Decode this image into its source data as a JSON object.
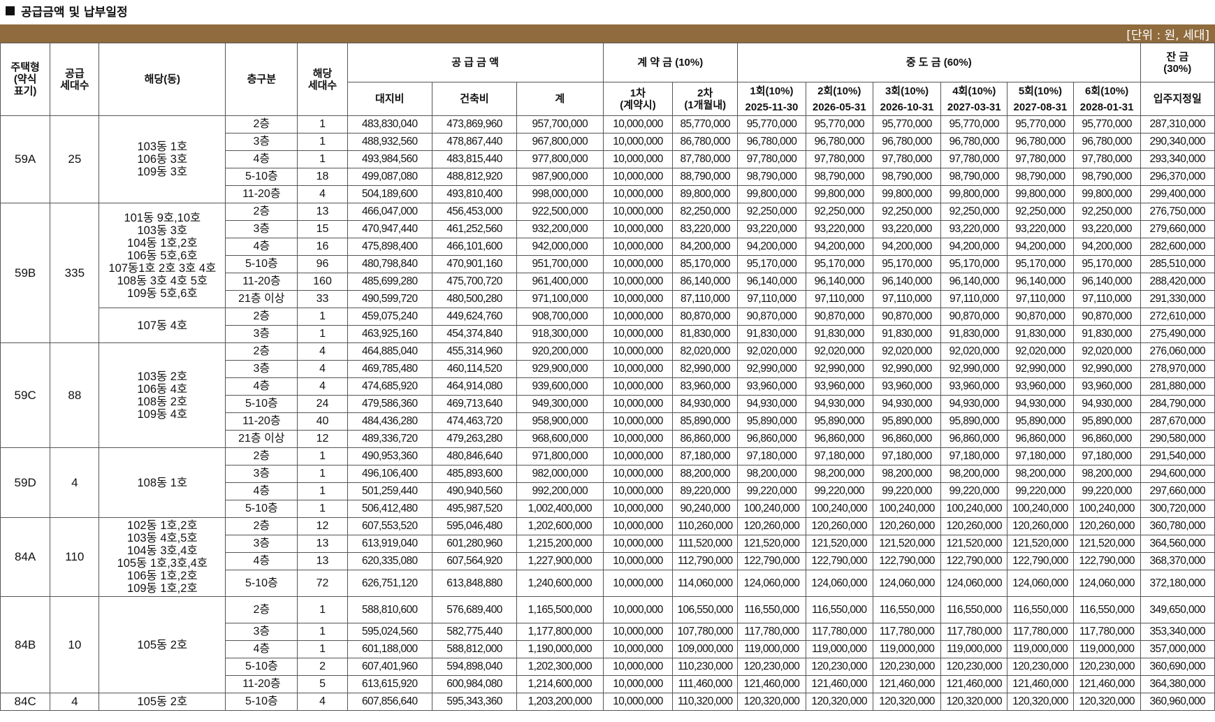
{
  "title": "공급금액 및 납부일정",
  "unit_note": "[단위 : 원, 세대]",
  "headers": {
    "house_type": [
      "주택형",
      "(약식",
      "표기)"
    ],
    "supply_units": [
      "공급",
      "세대수"
    ],
    "dong": "해당(동)",
    "floor": "층구분",
    "units": [
      "해당",
      "세대수"
    ],
    "supply_price": "공 급 금 액",
    "land": "대지비",
    "building": "건축비",
    "total": "계",
    "deposit": "계 약 금 (10%)",
    "dep1": [
      "1차",
      "(계약시)"
    ],
    "dep2": [
      "2차",
      "(1개월내)"
    ],
    "middle": "중 도 금 (60%)",
    "middle_rounds": [
      "1회(10%)",
      "2회(10%)",
      "3회(10%)",
      "4회(10%)",
      "5회(10%)",
      "6회(10%)"
    ],
    "middle_dates": [
      "2025-11-30",
      "2026-05-31",
      "2026-10-31",
      "2027-03-31",
      "2027-08-31",
      "2028-01-31"
    ],
    "balance": [
      "잔 금",
      "(30%)"
    ],
    "move_in": "입주지정일"
  },
  "groups": [
    {
      "type": "59A",
      "supply": "25",
      "blocks": [
        {
          "dong": [
            "103동 1호",
            "106동 3호",
            "109동 3호"
          ],
          "rows": [
            {
              "floor": "2층",
              "units": "1",
              "land": "483,830,040",
              "building": "473,869,960",
              "total": "957,700,000",
              "d1": "10,000,000",
              "d2": "85,770,000",
              "m": "95,770,000",
              "bal": "287,310,000"
            },
            {
              "floor": "3층",
              "units": "1",
              "land": "488,932,560",
              "building": "478,867,440",
              "total": "967,800,000",
              "d1": "10,000,000",
              "d2": "86,780,000",
              "m": "96,780,000",
              "bal": "290,340,000"
            },
            {
              "floor": "4층",
              "units": "1",
              "land": "493,984,560",
              "building": "483,815,440",
              "total": "977,800,000",
              "d1": "10,000,000",
              "d2": "87,780,000",
              "m": "97,780,000",
              "bal": "293,340,000"
            },
            {
              "floor": "5-10층",
              "units": "18",
              "land": "499,087,080",
              "building": "488,812,920",
              "total": "987,900,000",
              "d1": "10,000,000",
              "d2": "88,790,000",
              "m": "98,790,000",
              "bal": "296,370,000"
            },
            {
              "floor": "11-20층",
              "units": "4",
              "land": "504,189,600",
              "building": "493,810,400",
              "total": "998,000,000",
              "d1": "10,000,000",
              "d2": "89,800,000",
              "m": "99,800,000",
              "bal": "299,400,000"
            }
          ]
        }
      ]
    },
    {
      "type": "59B",
      "supply": "335",
      "blocks": [
        {
          "dong": [
            "101동 9호,10호",
            "103동 3호",
            "104동 1호,2호",
            "106동 5호,6호",
            "107동1호 2호 3호 4호",
            "108동 3호 4호 5호",
            "109동 5호,6호"
          ],
          "rows": [
            {
              "floor": "2층",
              "units": "13",
              "land": "466,047,000",
              "building": "456,453,000",
              "total": "922,500,000",
              "d1": "10,000,000",
              "d2": "82,250,000",
              "m": "92,250,000",
              "bal": "276,750,000"
            },
            {
              "floor": "3층",
              "units": "15",
              "land": "470,947,440",
              "building": "461,252,560",
              "total": "932,200,000",
              "d1": "10,000,000",
              "d2": "83,220,000",
              "m": "93,220,000",
              "bal": "279,660,000"
            },
            {
              "floor": "4층",
              "units": "16",
              "land": "475,898,400",
              "building": "466,101,600",
              "total": "942,000,000",
              "d1": "10,000,000",
              "d2": "84,200,000",
              "m": "94,200,000",
              "bal": "282,600,000"
            },
            {
              "floor": "5-10층",
              "units": "96",
              "land": "480,798,840",
              "building": "470,901,160",
              "total": "951,700,000",
              "d1": "10,000,000",
              "d2": "85,170,000",
              "m": "95,170,000",
              "bal": "285,510,000"
            },
            {
              "floor": "11-20층",
              "units": "160",
              "land": "485,699,280",
              "building": "475,700,720",
              "total": "961,400,000",
              "d1": "10,000,000",
              "d2": "86,140,000",
              "m": "96,140,000",
              "bal": "288,420,000"
            },
            {
              "floor": "21층 이상",
              "units": "33",
              "land": "490,599,720",
              "building": "480,500,280",
              "total": "971,100,000",
              "d1": "10,000,000",
              "d2": "87,110,000",
              "m": "97,110,000",
              "bal": "291,330,000"
            }
          ]
        },
        {
          "dong": [
            "107동 4호"
          ],
          "rows": [
            {
              "floor": "2층",
              "units": "1",
              "land": "459,075,240",
              "building": "449,624,760",
              "total": "908,700,000",
              "d1": "10,000,000",
              "d2": "80,870,000",
              "m": "90,870,000",
              "bal": "272,610,000"
            },
            {
              "floor": "3층",
              "units": "1",
              "land": "463,925,160",
              "building": "454,374,840",
              "total": "918,300,000",
              "d1": "10,000,000",
              "d2": "81,830,000",
              "m": "91,830,000",
              "bal": "275,490,000"
            }
          ]
        }
      ]
    },
    {
      "type": "59C",
      "supply": "88",
      "blocks": [
        {
          "dong": [
            "103동 2호",
            "106동 4호",
            "108동 2호",
            "109동 4호"
          ],
          "rows": [
            {
              "floor": "2층",
              "units": "4",
              "land": "464,885,040",
              "building": "455,314,960",
              "total": "920,200,000",
              "d1": "10,000,000",
              "d2": "82,020,000",
              "m": "92,020,000",
              "bal": "276,060,000"
            },
            {
              "floor": "3층",
              "units": "4",
              "land": "469,785,480",
              "building": "460,114,520",
              "total": "929,900,000",
              "d1": "10,000,000",
              "d2": "82,990,000",
              "m": "92,990,000",
              "bal": "278,970,000"
            },
            {
              "floor": "4층",
              "units": "4",
              "land": "474,685,920",
              "building": "464,914,080",
              "total": "939,600,000",
              "d1": "10,000,000",
              "d2": "83,960,000",
              "m": "93,960,000",
              "bal": "281,880,000"
            },
            {
              "floor": "5-10층",
              "units": "24",
              "land": "479,586,360",
              "building": "469,713,640",
              "total": "949,300,000",
              "d1": "10,000,000",
              "d2": "84,930,000",
              "m": "94,930,000",
              "bal": "284,790,000"
            },
            {
              "floor": "11-20층",
              "units": "40",
              "land": "484,436,280",
              "building": "474,463,720",
              "total": "958,900,000",
              "d1": "10,000,000",
              "d2": "85,890,000",
              "m": "95,890,000",
              "bal": "287,670,000"
            },
            {
              "floor": "21층 이상",
              "units": "12",
              "land": "489,336,720",
              "building": "479,263,280",
              "total": "968,600,000",
              "d1": "10,000,000",
              "d2": "86,860,000",
              "m": "96,860,000",
              "bal": "290,580,000"
            }
          ]
        }
      ]
    },
    {
      "type": "59D",
      "supply": "4",
      "blocks": [
        {
          "dong": [
            "108동 1호"
          ],
          "rows": [
            {
              "floor": "2층",
              "units": "1",
              "land": "490,953,360",
              "building": "480,846,640",
              "total": "971,800,000",
              "d1": "10,000,000",
              "d2": "87,180,000",
              "m": "97,180,000",
              "bal": "291,540,000"
            },
            {
              "floor": "3층",
              "units": "1",
              "land": "496,106,400",
              "building": "485,893,600",
              "total": "982,000,000",
              "d1": "10,000,000",
              "d2": "88,200,000",
              "m": "98,200,000",
              "bal": "294,600,000"
            },
            {
              "floor": "4층",
              "units": "1",
              "land": "501,259,440",
              "building": "490,940,560",
              "total": "992,200,000",
              "d1": "10,000,000",
              "d2": "89,220,000",
              "m": "99,220,000",
              "bal": "297,660,000"
            },
            {
              "floor": "5-10층",
              "units": "1",
              "land": "506,412,480",
              "building": "495,987,520",
              "total": "1,002,400,000",
              "d1": "10,000,000",
              "d2": "90,240,000",
              "m": "100,240,000",
              "bal": "300,720,000"
            }
          ]
        }
      ]
    },
    {
      "type": "84A",
      "supply": "110",
      "blocks": [
        {
          "dong": [
            "102동 1호,2호",
            "103동 4호,5호",
            "104동 3호,4호",
            "105동 1호,3호,4호",
            "106동 1호,2호",
            "109동 1호,2호"
          ],
          "rows": [
            {
              "floor": "2층",
              "units": "12",
              "land": "607,553,520",
              "building": "595,046,480",
              "total": "1,202,600,000",
              "d1": "10,000,000",
              "d2": "110,260,000",
              "m": "120,260,000",
              "bal": "360,780,000"
            },
            {
              "floor": "3층",
              "units": "13",
              "land": "613,919,040",
              "building": "601,280,960",
              "total": "1,215,200,000",
              "d1": "10,000,000",
              "d2": "111,520,000",
              "m": "121,520,000",
              "bal": "364,560,000"
            },
            {
              "floor": "4층",
              "units": "13",
              "land": "620,335,080",
              "building": "607,564,920",
              "total": "1,227,900,000",
              "d1": "10,000,000",
              "d2": "112,790,000",
              "m": "122,790,000",
              "bal": "368,370,000"
            },
            {
              "floor": "5-10층",
              "units": "72",
              "land": "626,751,120",
              "building": "613,848,880",
              "total": "1,240,600,000",
              "d1": "10,000,000",
              "d2": "114,060,000",
              "m": "124,060,000",
              "bal": "372,180,000",
              "tall": true
            }
          ]
        }
      ]
    },
    {
      "type": "84B",
      "supply": "10",
      "blocks": [
        {
          "dong": [
            "105동 2호"
          ],
          "rows": [
            {
              "floor": "2층",
              "units": "1",
              "land": "588,810,600",
              "building": "576,689,400",
              "total": "1,165,500,000",
              "d1": "10,000,000",
              "d2": "106,550,000",
              "m": "116,550,000",
              "bal": "349,650,000",
              "tall": true
            },
            {
              "floor": "3층",
              "units": "1",
              "land": "595,024,560",
              "building": "582,775,440",
              "total": "1,177,800,000",
              "d1": "10,000,000",
              "d2": "107,780,000",
              "m": "117,780,000",
              "bal": "353,340,000"
            },
            {
              "floor": "4층",
              "units": "1",
              "land": "601,188,000",
              "building": "588,812,000",
              "total": "1,190,000,000",
              "d1": "10,000,000",
              "d2": "109,000,000",
              "m": "119,000,000",
              "bal": "357,000,000"
            },
            {
              "floor": "5-10층",
              "units": "2",
              "land": "607,401,960",
              "building": "594,898,040",
              "total": "1,202,300,000",
              "d1": "10,000,000",
              "d2": "110,230,000",
              "m": "120,230,000",
              "bal": "360,690,000"
            },
            {
              "floor": "11-20층",
              "units": "5",
              "land": "613,615,920",
              "building": "600,984,080",
              "total": "1,214,600,000",
              "d1": "10,000,000",
              "d2": "111,460,000",
              "m": "121,460,000",
              "bal": "364,380,000"
            }
          ]
        }
      ]
    },
    {
      "type": "84C",
      "supply": "4",
      "blocks": [
        {
          "dong": [
            "105동 2호"
          ],
          "rows": [
            {
              "floor": "5-10층",
              "units": "4",
              "land": "607,856,640",
              "building": "595,343,360",
              "total": "1,203,200,000",
              "d1": "10,000,000",
              "d2": "110,320,000",
              "m": "120,320,000",
              "bal": "360,960,000"
            }
          ]
        }
      ]
    }
  ]
}
